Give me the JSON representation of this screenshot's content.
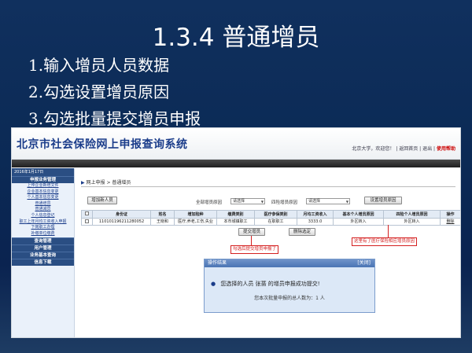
{
  "slide": {
    "title": "1.3.4 普通增员",
    "steps": [
      "1.输入增员人员数据",
      "2.勾选设置增员原因",
      "3.勾选批量提交增员申报"
    ]
  },
  "app": {
    "title": "北京市社会保险网上申报查询系统",
    "top_links": {
      "user": "北京大学，欢迎您！",
      "home": "返回首页",
      "logout": "退出",
      "emph": "使用帮助"
    },
    "date": "2016年1月17日",
    "sidebar": {
      "sections": [
        "申报业务管理",
        "查询管理",
        "用户管理",
        "业务基本查询",
        "信息下载"
      ],
      "items": [
        "上传企业新增文件",
        "企业基本信息变更",
        "个人基本信息变更",
        "普通增员",
        "普通减员",
        "个人信息登记",
        "职工上年月均工资收入申报",
        "下岗职工办理",
        "补缴单位缴费"
      ]
    },
    "breadcrumb": {
      "root": "网上申报",
      "current": "普通增员"
    },
    "toolbar": {
      "add_button": "增加新人员",
      "insured_reason_label": "全部增员原因",
      "insured_reason_value": "请选择",
      "medical_reason_label": "四险增员原因",
      "medical_reason_value": "请选择",
      "set_reason_button": "设置增员原因"
    },
    "table": {
      "headers": [
        "",
        "身份证",
        "姓名",
        "增加险种",
        "缴费类别",
        "医疗参保类别",
        "月均工资收入",
        "基本个人增员原因",
        "四险个人增员原因",
        "操作"
      ],
      "rows": [
        [
          "",
          "110101196211280052",
          "王晓和",
          "医疗,养老,工伤,失业",
          "本市城镇职工",
          "在职职工",
          "3333.0",
          "外区转入",
          "外区转入",
          "删除"
        ]
      ]
    },
    "actions": {
      "submit": "提交增员",
      "cancel": "删除选定"
    },
    "annotations": {
      "submit_note": "勾选后提交增员申报了",
      "reason_note": "这里有了医疗保险相应增员原因"
    },
    "dialog": {
      "title": "操作结果",
      "close": "[关闭]",
      "message": "您选择的人员  张蔷  的增员申报成功提交!",
      "summary": "您本次批量申报的总人数为：1 人"
    }
  }
}
